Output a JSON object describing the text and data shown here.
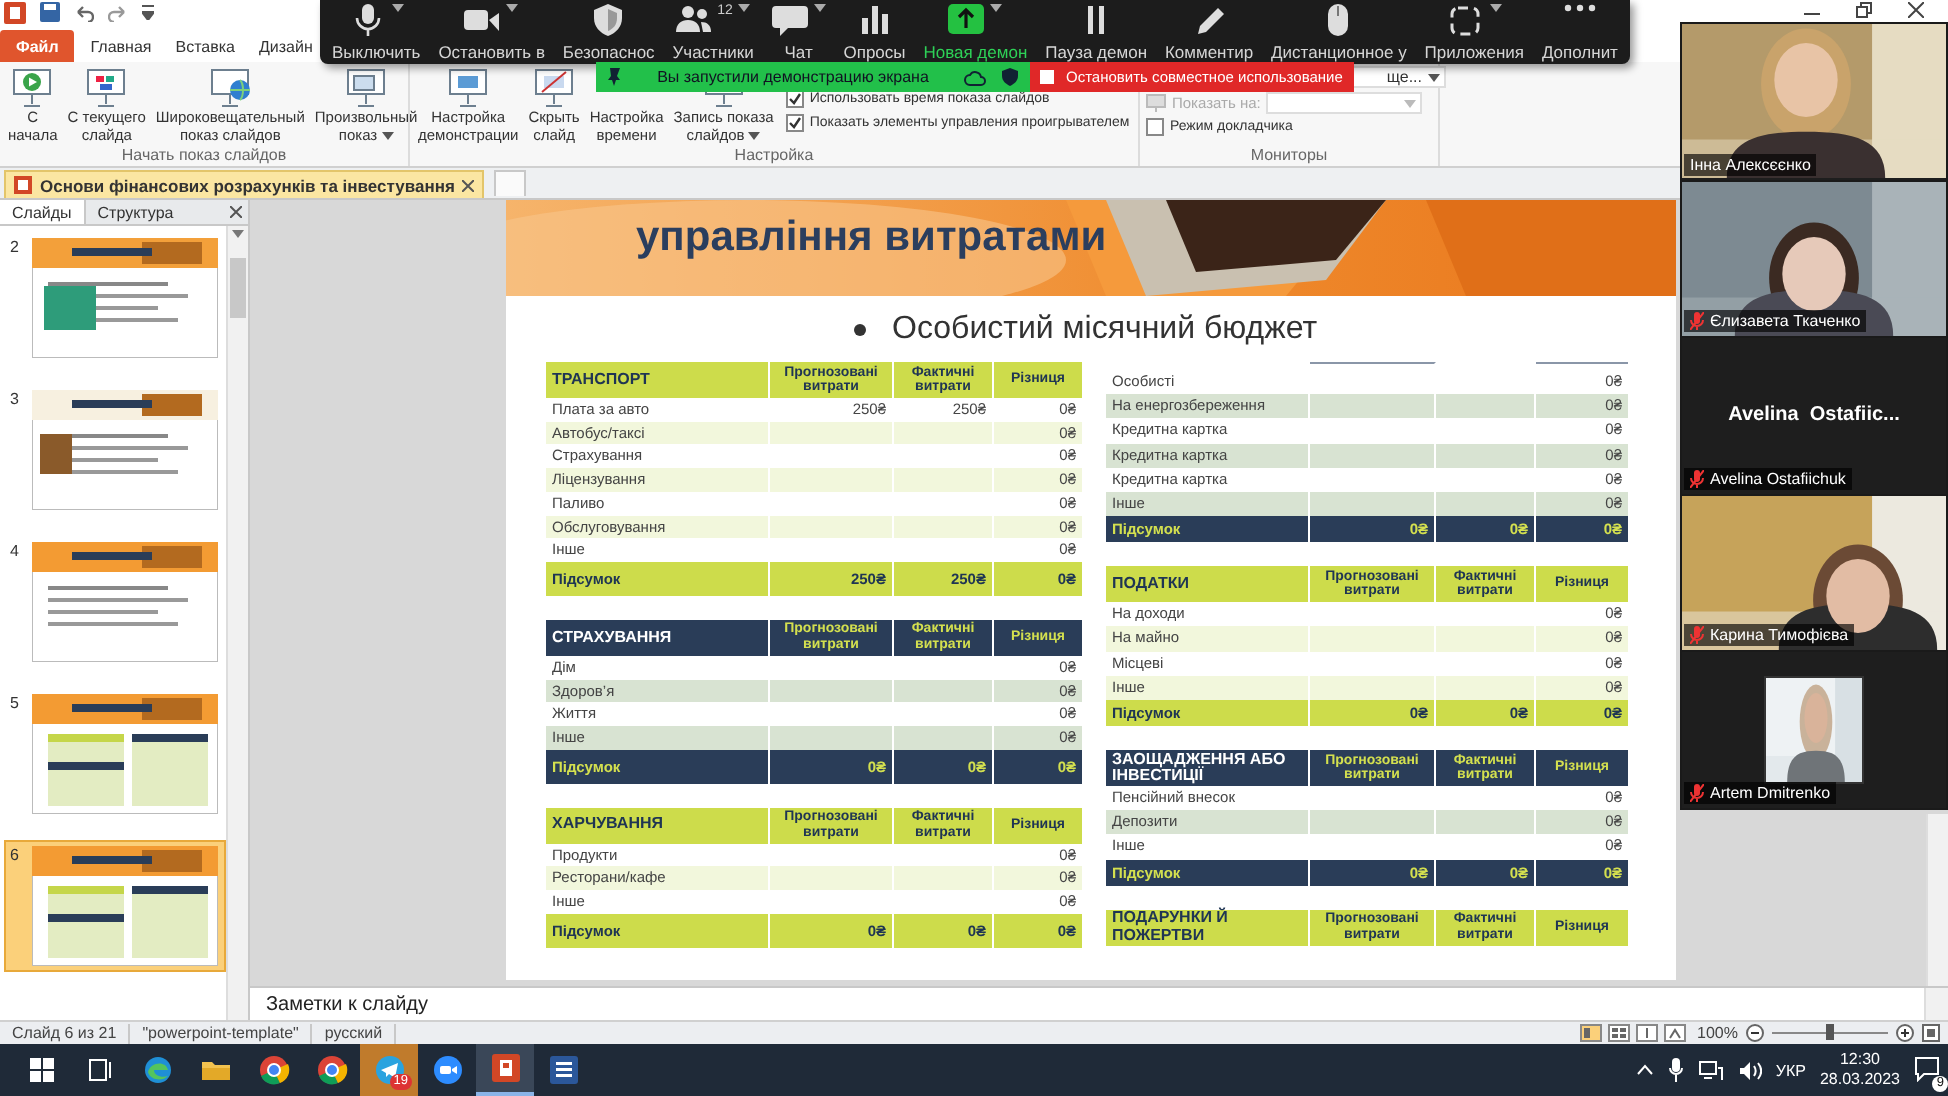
{
  "ribbon_tabs": [
    {
      "label": "Файл",
      "kind": "file"
    },
    {
      "label": "Главная",
      "kind": "tab"
    },
    {
      "label": "Вставка",
      "kind": "tab"
    },
    {
      "label": "Дизайн",
      "kind": "tab"
    }
  ],
  "ribbon_groups": [
    {
      "label": "Начать показ слайдов",
      "buttons": [
        {
          "label": "С\nначала"
        },
        {
          "label": "С текущего\nслайда"
        },
        {
          "label": "Широковещательный\nпоказ слайдов"
        },
        {
          "label": "Произвольный\nпоказ",
          "dropdown": true
        }
      ]
    },
    {
      "label": "Настройка",
      "buttons": [
        {
          "label": "Настройка\nдемонстрации"
        },
        {
          "label": "Скрыть\nслайд"
        },
        {
          "label": "Настройка\nвремени"
        },
        {
          "label": "Запись показа\nслайдов",
          "dropdown": true
        }
      ],
      "checkboxes": [
        {
          "label": "Использовать время показа слайдов",
          "checked": true
        },
        {
          "label": "Показать элементы управления проигрывателем",
          "checked": true
        }
      ]
    },
    {
      "label": "Мониторы",
      "dropdowns": [
        {
          "value": "ще...",
          "disabled": false
        },
        {
          "label": "Показать на:",
          "disabled": true
        }
      ],
      "checkboxes": [
        {
          "label": "Режим докладчика",
          "checked": false
        }
      ]
    }
  ],
  "meeting_toolbar": {
    "items": [
      {
        "label": "Выключить",
        "caret": true,
        "highlighted": false
      },
      {
        "label": "Остановить в",
        "caret": true,
        "highlighted": false
      },
      {
        "label": "Безопаснос",
        "caret": false,
        "highlighted": false
      },
      {
        "label": "Участники",
        "count": "12",
        "caret": true,
        "highlighted": false
      },
      {
        "label": "Чат",
        "caret": true,
        "highlighted": false
      },
      {
        "label": "Опросы",
        "caret": false,
        "highlighted": false
      },
      {
        "label": "Новая демон",
        "caret": true,
        "highlighted": true
      },
      {
        "label": "Пауза демон",
        "caret": false,
        "highlighted": false
      },
      {
        "label": "Комментир",
        "caret": false,
        "highlighted": false
      },
      {
        "label": "Дистанционное у",
        "caret": false,
        "highlighted": false
      },
      {
        "label": "Приложения",
        "caret": true,
        "highlighted": false
      },
      {
        "label": "Дополнит",
        "caret": false,
        "highlighted": false
      }
    ]
  },
  "sharing_banner": {
    "text": "Вы запустили демонстрацию экрана",
    "stop_button": "Остановить совместное использование"
  },
  "document_tab": {
    "title": "Основи фінансових розрахунків та інвестування"
  },
  "slides_panel": {
    "tabs": [
      {
        "label": "Слайды",
        "selected": true
      },
      {
        "label": "Структура",
        "selected": false
      }
    ],
    "slides": [
      {
        "number": "2",
        "selected": false
      },
      {
        "number": "3",
        "selected": false
      },
      {
        "number": "4",
        "selected": false
      },
      {
        "number": "5",
        "selected": false
      },
      {
        "number": "6",
        "selected": true
      }
    ]
  },
  "slide": {
    "title": "управління витратами",
    "bullet": "Особистий місячний бюджет",
    "left_tables": [
      {
        "title": "ТРАНСПОРТ",
        "kind": "light",
        "columns": [
          "Прогнозовані витрати",
          "Фактичні витрати",
          "Різниця"
        ],
        "rows": [
          {
            "label": "Плата за авто",
            "planned": "250₴",
            "actual": "250₴",
            "difference": "0₴"
          },
          {
            "label": "Автобус/таксі",
            "difference": "0₴"
          },
          {
            "label": "Страхування",
            "difference": "0₴"
          },
          {
            "label": "Ліцензування",
            "difference": "0₴"
          },
          {
            "label": "Паливо",
            "difference": "0₴"
          },
          {
            "label": "Обслуговування",
            "difference": "0₴"
          },
          {
            "label": "Інше",
            "difference": "0₴"
          }
        ],
        "total": {
          "label": "Підсумок",
          "planned": "250₴",
          "actual": "250₴",
          "difference": "0₴"
        }
      },
      {
        "title": "СТРАХУВАННЯ",
        "kind": "dark",
        "columns": [
          "Прогнозовані витрати",
          "Фактичні витрати",
          "Різниця"
        ],
        "rows": [
          {
            "label": "Дім",
            "difference": "0₴"
          },
          {
            "label": "Здоров’я",
            "difference": "0₴"
          },
          {
            "label": "Життя",
            "difference": "0₴"
          },
          {
            "label": "Інше",
            "difference": "0₴"
          }
        ],
        "total": {
          "label": "Підсумок",
          "planned": "0₴",
          "actual": "0₴",
          "difference": "0₴"
        }
      },
      {
        "title": "ХАРЧУВАННЯ",
        "kind": "light",
        "columns": [
          "Прогнозовані витрати",
          "Фактичні витрати",
          "Різниця"
        ],
        "rows": [
          {
            "label": "Продукти",
            "difference": "0₴"
          },
          {
            "label": "Ресторани/кафе",
            "difference": "0₴"
          },
          {
            "label": "Інше",
            "difference": "0₴"
          }
        ],
        "total": {
          "label": "Підсумок",
          "planned": "0₴",
          "actual": "0₴",
          "difference": "0₴"
        }
      }
    ],
    "right_tables": [
      {
        "kind": "dark",
        "rows": [
          {
            "label": "Особисті",
            "difference": "0₴"
          },
          {
            "label": "На енергозбереження",
            "difference": "0₴"
          },
          {
            "label": "Кредитна картка",
            "difference": "0₴"
          },
          {
            "label": "Кредитна картка",
            "difference": "0₴"
          },
          {
            "label": "Кредитна картка",
            "difference": "0₴"
          },
          {
            "label": "Інше",
            "difference": "0₴"
          }
        ],
        "total": {
          "label": "Підсумок",
          "planned": "0₴",
          "actual": "0₴",
          "difference": "0₴"
        }
      },
      {
        "title": "ПОДАТКИ",
        "kind": "light",
        "columns": [
          "Прогнозовані витрати",
          "Фактичні витрати",
          "Різниця"
        ],
        "rows": [
          {
            "label": "На доходи",
            "difference": "0₴"
          },
          {
            "label": "На майно",
            "difference": "0₴"
          },
          {
            "label": "Місцеві",
            "difference": "0₴"
          },
          {
            "label": "Інше",
            "difference": "0₴"
          }
        ],
        "total": {
          "label": "Підсумок",
          "planned": "0₴",
          "actual": "0₴",
          "difference": "0₴"
        }
      },
      {
        "title": "ЗАОЩАДЖЕННЯ АБО ІНВЕСТИЦІЇ",
        "kind": "dark",
        "columns": [
          "Прогнозовані витрати",
          "Фактичні витрати",
          "Різниця"
        ],
        "rows": [
          {
            "label": "Пенсійний внесок",
            "difference": "0₴"
          },
          {
            "label": "Депозити",
            "difference": "0₴"
          },
          {
            "label": "Інше",
            "difference": "0₴"
          }
        ],
        "total": {
          "label": "Підсумок",
          "planned": "0₴",
          "actual": "0₴",
          "difference": "0₴"
        }
      },
      {
        "title": "ПОДАРУНКИ Й ПОЖЕРТВИ",
        "kind": "light",
        "columns": [
          "Прогнозовані витрати",
          "Фактичні витрати",
          "Різниця"
        ]
      }
    ]
  },
  "notes": {
    "placeholder": "Заметки к слайду"
  },
  "status_bar": {
    "slide": "Слайд 6 из 21",
    "theme": "\"powerpoint-template\"",
    "language": "русский",
    "zoom": "100%",
    "zoom_slider": {
      "level": 0.5
    }
  },
  "video_panel": {
    "participants": [
      {
        "name": "Інна Алексєєнко",
        "kind": "video",
        "muted": false
      },
      {
        "name": "Єлизавета Ткаченко",
        "kind": "video",
        "muted": true
      },
      {
        "name": "Avelina Ostafiichuk",
        "display_name": "Avelina  Ostafiic...",
        "kind": "name",
        "muted": true
      },
      {
        "name": "Карина Тимофієва",
        "kind": "video",
        "muted": true
      },
      {
        "name": "Artem Dmitrenko",
        "muted": true
      }
    ]
  },
  "taskbar": {
    "apps": [
      {
        "active": false,
        "highlighted": false
      },
      {
        "active": false,
        "highlighted": false
      },
      {
        "active": false,
        "highlighted": false
      },
      {
        "active": false,
        "highlighted": false
      },
      {
        "active": false,
        "highlighted": false
      },
      {
        "active": false,
        "highlighted": false
      },
      {
        "active": false,
        "highlighted": true,
        "badge": "19"
      },
      {
        "active": false,
        "highlighted": false
      },
      {
        "active": true,
        "highlighted": false
      },
      {
        "active": false,
        "highlighted": false
      }
    ],
    "tray": {
      "language": "УКР",
      "time": "12:30",
      "date": "28.03.2023",
      "notifications": "9"
    }
  }
}
